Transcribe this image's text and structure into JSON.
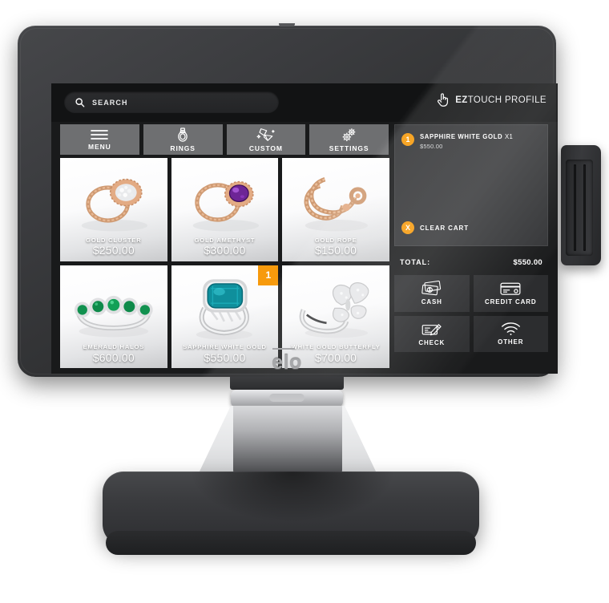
{
  "device": {
    "brand": "elo",
    "peripheral_name": "magnetic-stripe-reader"
  },
  "screen": {
    "search": {
      "placeholder": "SEARCH",
      "icon": "search-icon"
    },
    "profile": {
      "bold_text": "EZ",
      "light_text": "TOUCH PROFILE",
      "icon": "hand-tap-icon"
    },
    "nav": [
      {
        "label": "MENU",
        "icon": "hamburger-menu-icon"
      },
      {
        "label": "RINGS",
        "icon": "ring-icon"
      },
      {
        "label": "CUSTOM",
        "icon": "gems-icon"
      },
      {
        "label": "SETTINGS",
        "icon": "gears-icon"
      }
    ],
    "products": [
      {
        "name": "GOLD CLUSTER",
        "price": "$250.00",
        "badge": null,
        "image": "gold-cluster-ring"
      },
      {
        "name": "GOLD AMETHYST",
        "price": "$300.00",
        "badge": null,
        "image": "gold-amethyst-ring"
      },
      {
        "name": "GOLD ROPE",
        "price": "$150.00",
        "badge": null,
        "image": "gold-rope-ring"
      },
      {
        "name": "EMERALD HALOS",
        "price": "$600.00",
        "badge": null,
        "image": "emerald-halos-ring"
      },
      {
        "name": "SAPPHIRE WHITE GOLD",
        "price": "$550.00",
        "badge": "1",
        "image": "sapphire-white-gold-ring"
      },
      {
        "name": "WHITE GOLD BUTTERFLY",
        "price": "$700.00",
        "badge": null,
        "image": "white-gold-butterfly-ring"
      }
    ],
    "cart": {
      "items": [
        {
          "qty_badge": "1",
          "name": "SAPPHIRE WHITE GOLD",
          "qty_text": "X1",
          "price": "$550.00"
        }
      ],
      "clear": {
        "label": "CLEAR CART",
        "badge": "X"
      },
      "total_label": "TOTAL:",
      "total_value": "$550.00"
    },
    "payments": [
      {
        "label": "CASH",
        "icon": "cash-bills-icon"
      },
      {
        "label": "CREDIT CARD",
        "icon": "credit-card-icon"
      },
      {
        "label": "CHECK",
        "icon": "check-pen-icon"
      },
      {
        "label": "OTHER",
        "icon": "contactless-wifi-icon"
      }
    ]
  },
  "colors": {
    "accent_orange": "#F79A0C",
    "nav_gray": "#6E6F71",
    "panel_dark": "#343537",
    "screen_black": "#191A1B"
  }
}
